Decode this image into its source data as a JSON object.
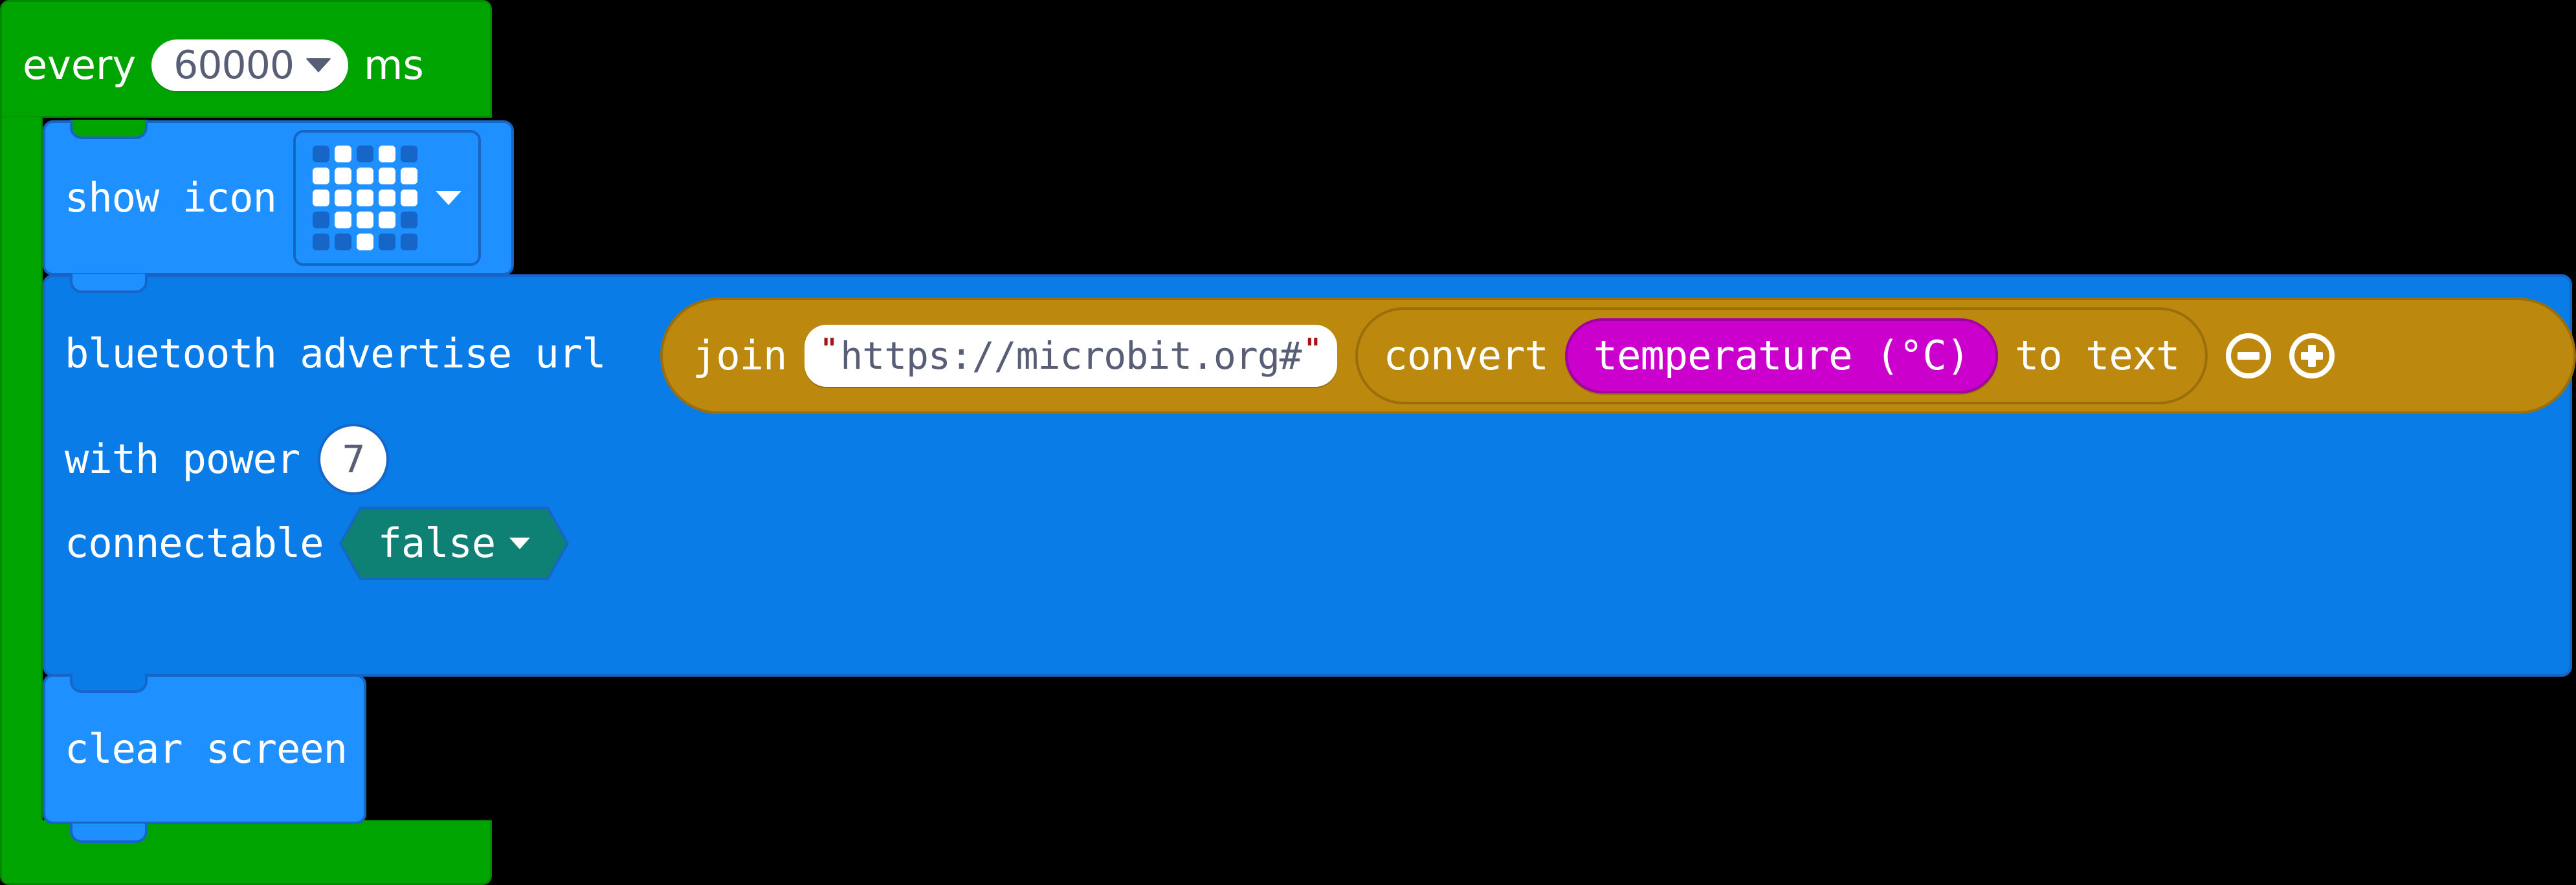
{
  "workspace": {
    "background_color": "#000000"
  },
  "blocks": {
    "forever": {
      "color": "#00A400",
      "label_every": "every",
      "interval_value": "60000",
      "label_ms": "ms",
      "dropdown_icon": "chevron-down-icon"
    },
    "show_icon": {
      "color": "#1E90FF",
      "label": "show icon",
      "icon_name": "heart",
      "dropdown_icon": "chevron-down-icon",
      "led_matrix": [
        [
          0,
          1,
          0,
          1,
          0
        ],
        [
          1,
          1,
          1,
          1,
          1
        ],
        [
          1,
          1,
          1,
          1,
          1
        ],
        [
          0,
          1,
          1,
          1,
          0
        ],
        [
          0,
          0,
          1,
          0,
          0
        ]
      ]
    },
    "bluetooth_advertise": {
      "color": "#0A7CE8",
      "label_main": "bluetooth advertise url",
      "label_power": "with power",
      "power_value": "7",
      "label_connectable": "connectable",
      "connectable_value": "false",
      "connectable_dropdown_icon": "chevron-down-icon"
    },
    "join": {
      "color": "#BC880E",
      "label": "join",
      "string_value": "https://microbit.org#",
      "quote_open": "\"",
      "quote_close": "\"",
      "minus_icon": "minus-circle-icon",
      "plus_icon": "plus-circle-icon"
    },
    "convert_to_text": {
      "color": "#BC880E",
      "label_prefix": "convert",
      "label_suffix": "to text"
    },
    "temperature": {
      "color": "#CC00CC",
      "label": "temperature (°C)"
    },
    "clear_screen": {
      "color": "#1E90FF",
      "label": "clear screen"
    }
  }
}
